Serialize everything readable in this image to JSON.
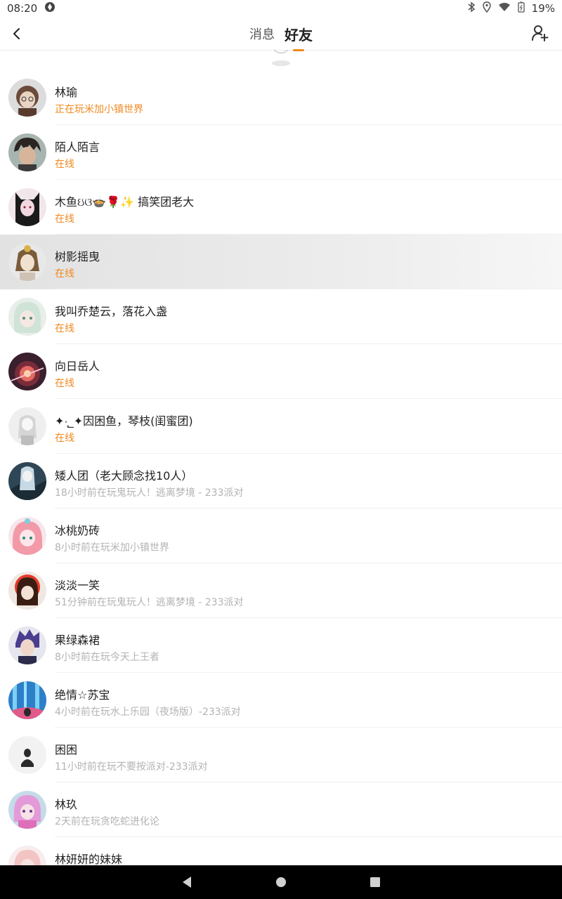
{
  "status_bar": {
    "time": "08:20",
    "battery": "19%",
    "icons": [
      "app-notification-icon",
      "bluetooth-icon",
      "location-icon",
      "wifi-icon",
      "battery-icon"
    ]
  },
  "header": {
    "tabs": [
      {
        "label": "消息",
        "active": false
      },
      {
        "label": "好友",
        "active": true
      }
    ],
    "accent_color": "#f0891f"
  },
  "friends": [
    {
      "name": "林瑜",
      "status": "正在玩米加小镇世界",
      "state": "online",
      "avatar_colors": [
        "#6b4a3a",
        "#e9d3c2"
      ]
    },
    {
      "name": "陌人陌言",
      "status": "在线",
      "state": "online",
      "avatar_colors": [
        "#2b2522",
        "#d7b59a"
      ]
    },
    {
      "name": "木鱼ઇଓ🍲🌹✨ 搞笑团老大",
      "status": "在线",
      "state": "online",
      "avatar_colors": [
        "#1a1a1a",
        "#f1d8e0"
      ]
    },
    {
      "name": "树影摇曳",
      "status": "在线",
      "state": "online",
      "avatar_colors": [
        "#7a5b3a",
        "#f0e0d0"
      ]
    },
    {
      "name": "我叫乔楚云，落花入盏",
      "status": "在线",
      "state": "online",
      "avatar_colors": [
        "#cfe3d6",
        "#f3e9e2"
      ]
    },
    {
      "name": "向日岳人",
      "status": "在线",
      "state": "online",
      "avatar_colors": [
        "#3a1f2d",
        "#e46a64"
      ]
    },
    {
      "name": "✦·̩͙_✦因困鱼，琴枝(闺蜜团)",
      "status": "在线",
      "state": "online",
      "avatar_colors": [
        "#e8e8e8",
        "#d5d5d5"
      ]
    },
    {
      "name": "矮人团（老大顾念找10人）",
      "status": "18小时前在玩鬼玩人！逃离梦境 - 233派对",
      "state": "offline",
      "avatar_colors": [
        "#2e4656",
        "#c8d9e6"
      ]
    },
    {
      "name": "冰桃奶砖",
      "status": "8小时前在玩米加小镇世界",
      "state": "offline",
      "avatar_colors": [
        "#f39aa8",
        "#fde7ea"
      ]
    },
    {
      "name": "淡淡一笑",
      "status": "51分钟前在玩鬼玩人！逃离梦境 - 233派对",
      "state": "offline",
      "avatar_colors": [
        "#3a1d12",
        "#e43a2a"
      ]
    },
    {
      "name": "果绿森裙",
      "status": "8小时前在玩今天上王者",
      "state": "offline",
      "avatar_colors": [
        "#4b3d8f",
        "#efd6c8"
      ]
    },
    {
      "name": "绝情☆苏宝",
      "status": "4小时前在玩水上乐园（夜场版）-233派对",
      "state": "offline",
      "avatar_colors": [
        "#2d7fc8",
        "#7dd0f5"
      ]
    },
    {
      "name": "困困",
      "status": "11小时前在玩不要按派对-233派对",
      "state": "offline",
      "avatar_colors": [
        "#f2f2f2",
        "#2a2a2a"
      ]
    },
    {
      "name": "林玖",
      "status": "2天前在玩贪吃蛇进化论",
      "state": "offline",
      "avatar_colors": [
        "#e49ad8",
        "#c5dbe8"
      ]
    },
    {
      "name": "林妍妍的妹妹",
      "status": "",
      "state": "offline",
      "avatar_colors": [
        "#f2c4c4",
        "#f8e3e3"
      ]
    }
  ]
}
